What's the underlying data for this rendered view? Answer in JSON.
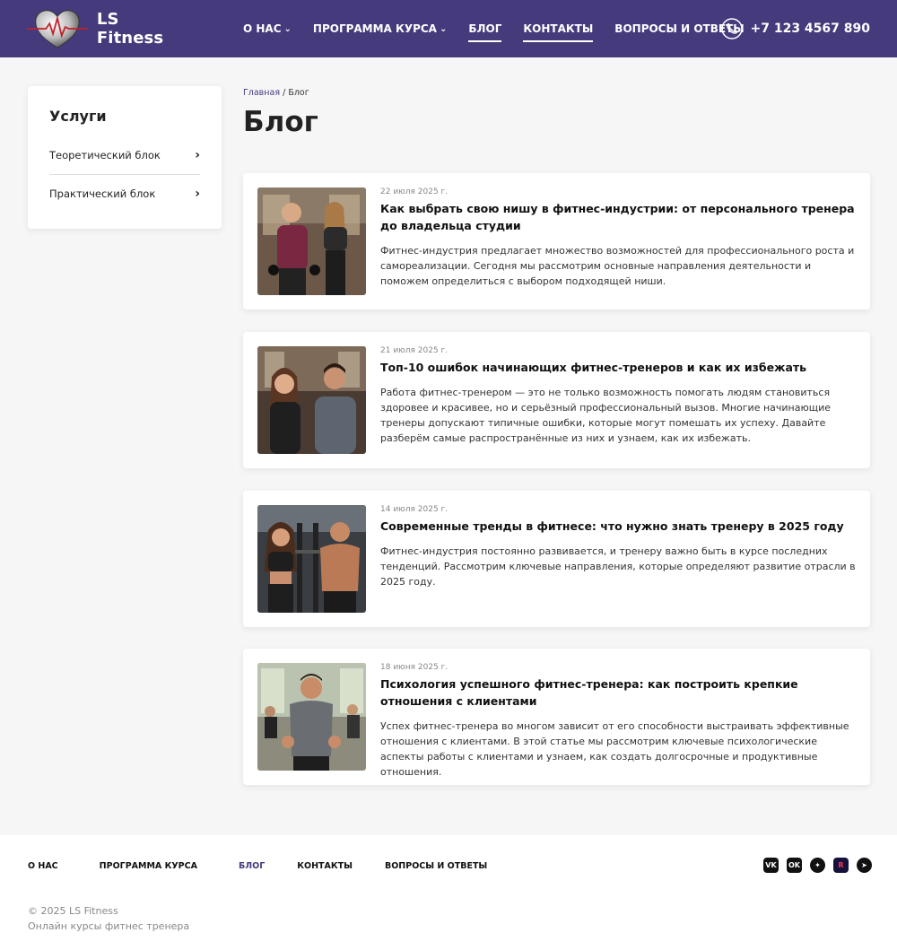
{
  "header": {
    "logo_text": "LS Fitness",
    "nav": [
      {
        "label": "О НАС",
        "has_dropdown": true
      },
      {
        "label": "ПРОГРАММА КУРСА",
        "has_dropdown": true
      },
      {
        "label": "БЛОГ",
        "has_dropdown": false
      },
      {
        "label": "КОНТАКТЫ",
        "has_dropdown": false
      },
      {
        "label": "ВОПРОСЫ И ОТВЕТЫ",
        "has_dropdown": false
      }
    ],
    "phone": "+7 123 4567 890"
  },
  "sidebar": {
    "title": "Услуги",
    "items": [
      {
        "label": "Теоретический блок"
      },
      {
        "label": "Практический блок"
      }
    ]
  },
  "breadcrumb": {
    "home": "Главная",
    "separator": "/",
    "current": "Блог"
  },
  "page_title": "Блог",
  "posts": [
    {
      "date": "22 июля 2025 г.",
      "title": "Как выбрать свою нишу в фитнес-индустрии: от персонального тренера до владельца студии",
      "excerpt": "Фитнес-индустрия предлагает множество возможностей для профессионального роста и самореализации. Сегодня мы рассмотрим основные направления деятельности и поможем определиться с выбором подходящей ниши."
    },
    {
      "date": "21 июля 2025 г.",
      "title": "Топ-10 ошибок начинающих фитнес-тренеров и как их избежать",
      "excerpt": "Работа фитнес-тренером — это не только возможность помогать людям становиться здоровее и красивее, но и серьёзный профессиональный вызов. Многие начинающие тренеры допускают типичные ошибки, которые могут помешать их успеху. Давайте разберём самые распространённые из них и узнаем, как их избежать."
    },
    {
      "date": "14 июля 2025 г.",
      "title": "Современные тренды в фитнесе: что нужно знать тренеру в 2025 году",
      "excerpt": "Фитнес-индустрия постоянно развивается, и тренеру важно быть в курсе последних тенденций. Рассмотрим ключевые направления, которые определяют развитие отрасли в 2025 году."
    },
    {
      "date": "18 июня 2025 г.",
      "title": "Психология успешного фитнес-тренера: как построить крепкие отношения с клиентами",
      "excerpt": "Успех фитнес-тренера во многом зависит от его способности выстраивать эффективные отношения с клиентами. В этой статье мы рассмотрим ключевые психологические аспекты работы с клиентами и узнаем, как создать долгосрочные и продуктивные отношения."
    }
  ],
  "footer": {
    "nav": [
      "О НАС",
      "ПРОГРАММА КУРСА",
      "БЛОГ",
      "КОНТАКТЫ",
      "ВОПРОСЫ И ОТВЕТЫ"
    ],
    "socials": [
      {
        "name": "vk-icon",
        "glyph": "VK"
      },
      {
        "name": "odnoklassniki-icon",
        "glyph": "OK"
      },
      {
        "name": "dzen-icon",
        "glyph": "✦"
      },
      {
        "name": "rutube-icon",
        "glyph": "R"
      },
      {
        "name": "telegram-icon",
        "glyph": "➤"
      }
    ],
    "copyright": "© 2025 LS Fitness",
    "tagline": "Онлайн курсы фитнес тренера"
  },
  "colors": {
    "brand": "#453a7c",
    "background": "#f6f6f6",
    "card": "#ffffff",
    "text": "#222222",
    "muted": "#888888",
    "heart": "#c4202a"
  }
}
